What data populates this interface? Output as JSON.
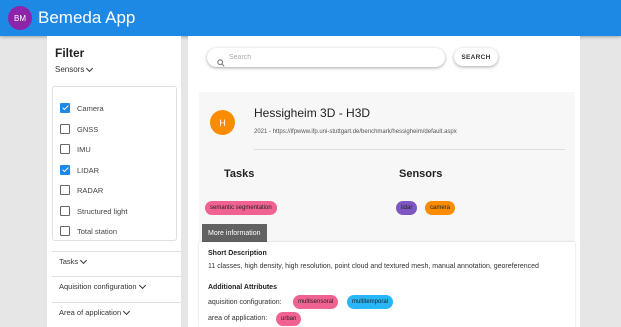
{
  "app": {
    "avatar_initials": "BM",
    "title": "Bemeda App"
  },
  "filter": {
    "title": "Filter",
    "sensors_toggle": "Sensors",
    "sensors": [
      {
        "label": "Camera",
        "checked": true
      },
      {
        "label": "GNSS",
        "checked": false
      },
      {
        "label": "IMU",
        "checked": false
      },
      {
        "label": "LIDAR",
        "checked": true
      },
      {
        "label": "RADAR",
        "checked": false
      },
      {
        "label": "Structured light",
        "checked": false
      },
      {
        "label": "Total station",
        "checked": false
      }
    ],
    "accordions": [
      "Tasks",
      "Aquisition configuration",
      "Area of application"
    ]
  },
  "search": {
    "placeholder": "Search",
    "value": "",
    "button": "SEARCH"
  },
  "dataset": {
    "avatar_letter": "H",
    "title": "Hessigheim 3D - H3D",
    "subtitle": "2021 - https://ifpwww.ifp.uni-stuttgart.de/benchmark/hessigheim/default.aspx",
    "tasks_heading": "Tasks",
    "sensors_heading": "Sensors",
    "tasks": [
      "semantic segmentation"
    ],
    "sensors": [
      "lidar",
      "camera"
    ],
    "more_button": "More information"
  },
  "description": {
    "short_heading": "Short Description",
    "short_text": "11 classes, high density, high resolution, point cloud and textured mesh, manual annotation, georeferenced",
    "additional_heading": "Additional Attributes",
    "acquisition_label": "aquisition configuration:",
    "acquisition_chips": [
      "multisensoral",
      "multitemporal"
    ],
    "area_label": "area of application:",
    "area_chips": [
      "urban"
    ]
  },
  "colors": {
    "appbar": "#1e88e5",
    "checkbox_checked": "#1e88e5",
    "chip_task": "#f06292",
    "chip_lidar": "#7e57c2",
    "chip_camera": "#fb8c00",
    "chip_multisensoral": "#f06292",
    "chip_multitemporal": "#29b6f6",
    "chip_urban": "#f06292"
  }
}
